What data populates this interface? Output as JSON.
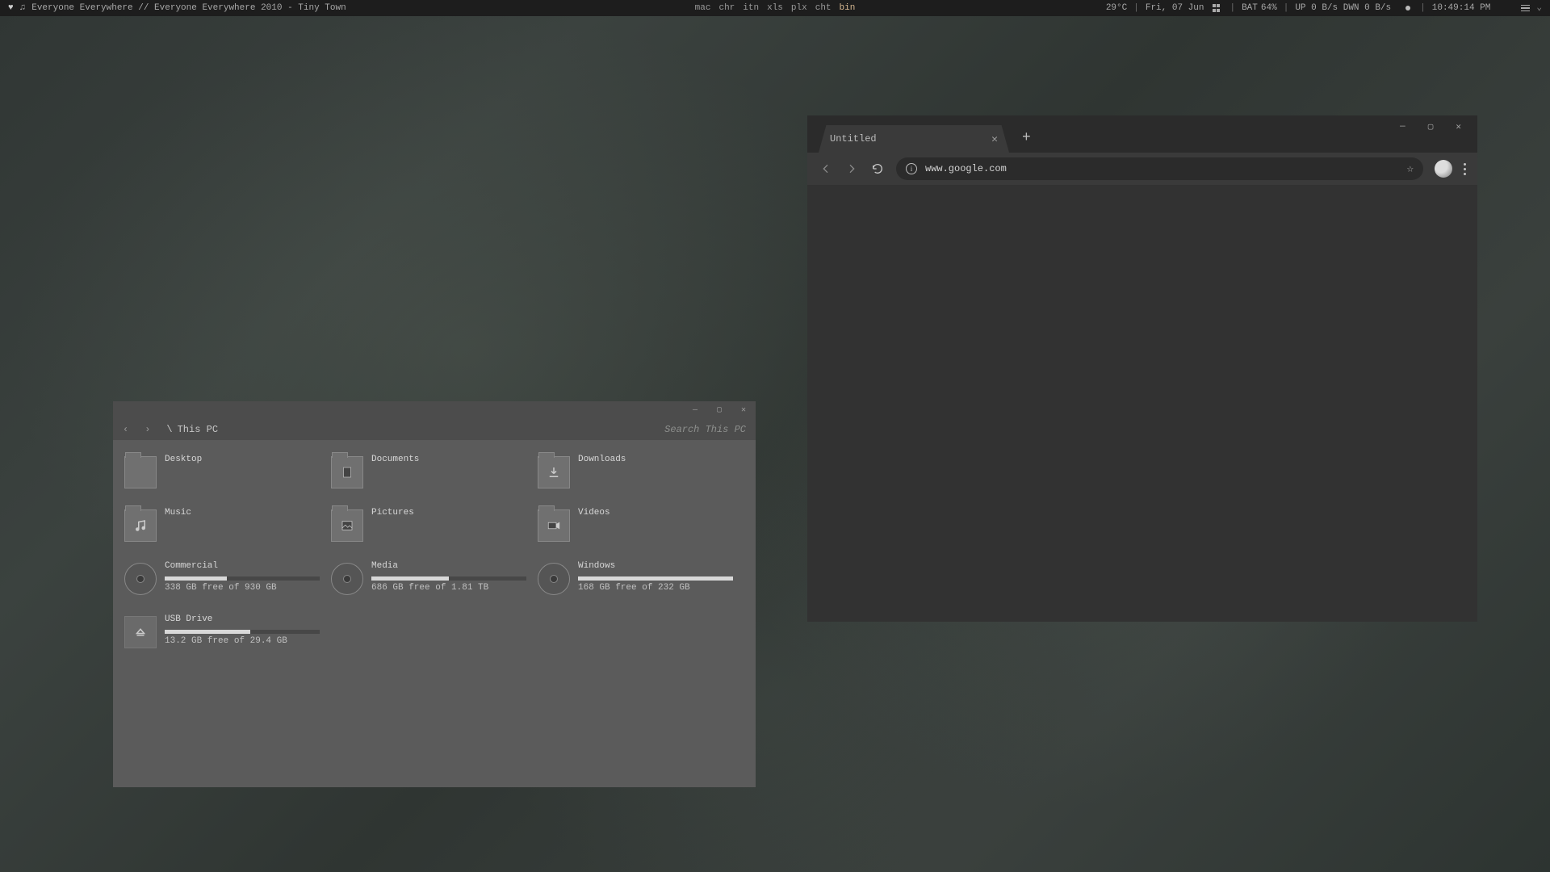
{
  "topbar": {
    "music": "Everyone Everywhere // Everyone Everywhere 2010 - Tiny Town",
    "workspaces": [
      "mac",
      "chr",
      "itn",
      "xls",
      "plx",
      "cht",
      "bin"
    ],
    "workspace_active_index": 6,
    "temp": "29°C",
    "date": "Fri, 07 Jun",
    "bat_label": "BAT",
    "bat_value": "64%",
    "net": "UP 0 B/s DWN 0 B/s",
    "time": "10:49:14 PM"
  },
  "fm": {
    "path_sep": "\\",
    "path": "This PC",
    "search_placeholder": "Search This PC",
    "folders": [
      {
        "name": "Desktop",
        "icon": "folder-blank"
      },
      {
        "name": "Documents",
        "icon": "document"
      },
      {
        "name": "Downloads",
        "icon": "download"
      },
      {
        "name": "Music",
        "icon": "music"
      },
      {
        "name": "Pictures",
        "icon": "picture"
      },
      {
        "name": "Videos",
        "icon": "video"
      }
    ],
    "drives": [
      {
        "name": "Commercial",
        "sub": "338 GB free of 930 GB",
        "pct": 40,
        "icon": "disk"
      },
      {
        "name": "Media",
        "sub": "686 GB free of 1.81 TB",
        "pct": 50,
        "icon": "disk"
      },
      {
        "name": "Windows",
        "sub": "168 GB free of 232 GB",
        "pct": 100,
        "icon": "disk"
      },
      {
        "name": "USB Drive",
        "sub": "13.2 GB free of 29.4 GB",
        "pct": 55,
        "icon": "usb"
      }
    ]
  },
  "browser": {
    "tab_title": "Untitled",
    "url": "www.google.com"
  }
}
